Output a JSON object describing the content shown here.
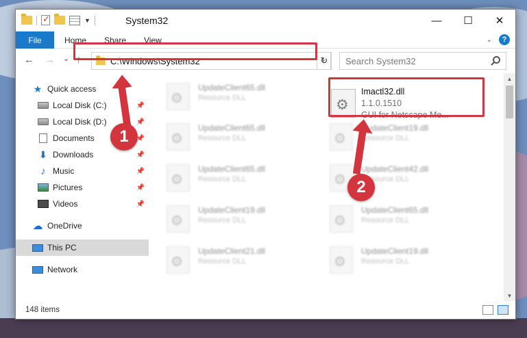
{
  "window": {
    "title": "System32",
    "controls": {
      "minimize": "—",
      "maximize": "☐",
      "close": "✕"
    }
  },
  "ribbon": {
    "tabs": [
      "File",
      "Home",
      "Share",
      "View"
    ],
    "help": "?"
  },
  "navigation": {
    "back": "←",
    "forward": "→",
    "recent": "⌄",
    "up": "↑",
    "address": "C:\\Windows\\System32",
    "refresh": "↻",
    "search_placeholder": "Search System32"
  },
  "sidebar": {
    "items": [
      {
        "label": "Quick access",
        "icon": "star-icon"
      },
      {
        "label": "Local Disk (C:)",
        "icon": "drive-icon",
        "pinned": true
      },
      {
        "label": "Local Disk (D:)",
        "icon": "drive-icon",
        "pinned": true
      },
      {
        "label": "Documents",
        "icon": "document-icon",
        "pinned": true
      },
      {
        "label": "Downloads",
        "icon": "download-icon",
        "pinned": true
      },
      {
        "label": "Music",
        "icon": "music-icon",
        "pinned": true
      },
      {
        "label": "Pictures",
        "icon": "pictures-icon",
        "pinned": true
      },
      {
        "label": "Videos",
        "icon": "videos-icon",
        "pinned": true
      },
      {
        "label": "OneDrive",
        "icon": "cloud-icon"
      },
      {
        "label": "This PC",
        "icon": "computer-icon",
        "selected": true
      },
      {
        "label": "Network",
        "icon": "network-icon"
      }
    ]
  },
  "files": {
    "left_column": [
      {
        "name": "UpdateClient65.dll",
        "type": "Resource DLL"
      },
      {
        "name": "UpdateClient65.dll",
        "type": "Resource DLL"
      },
      {
        "name": "UpdateClient65.dll",
        "type": "Resource DLL"
      },
      {
        "name": "UpdateClient19.dll",
        "type": "Resource DLL"
      },
      {
        "name": "UpdateClient21.dll",
        "type": "Resource DLL"
      }
    ],
    "right_column": [
      {
        "name": "UpdateClient19.dll",
        "type": "Resource DLL"
      },
      {
        "name": "UpdateClient42.dll",
        "type": "Resource DLL"
      },
      {
        "name": "UpdateClient65.dll",
        "type": "Resource DLL"
      },
      {
        "name": "UpdateClient19.dll",
        "type": "Resource DLL"
      }
    ],
    "featured": {
      "name": "Imactl32.dll",
      "version": "1.1.0.1510",
      "description": "GUI for Netscape Me..."
    }
  },
  "status": {
    "item_count": "148 items"
  },
  "callouts": [
    "1",
    "2"
  ],
  "colors": {
    "highlight": "#d2353d",
    "accent": "#1979ca"
  }
}
